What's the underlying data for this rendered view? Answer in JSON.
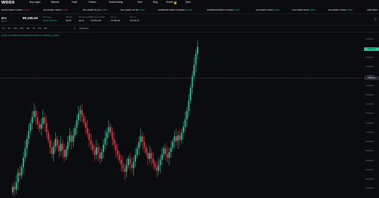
{
  "brand": {
    "name_prefix": "woo",
    "name_x": "x"
  },
  "nav": [
    {
      "label": "Buy crypto"
    },
    {
      "label": "Markets"
    },
    {
      "label": "Trade"
    },
    {
      "label": "Futures"
    },
    {
      "label": "Social trading"
    },
    {
      "label": "Earn"
    },
    {
      "label": "Blog"
    },
    {
      "label": "Events",
      "badge": "4"
    },
    {
      "label": "More"
    }
  ],
  "tickers": [
    {
      "symbol": "DOGE-PERP",
      "price": "0.20262",
      "change": "-0.80%",
      "dir": "neg"
    },
    {
      "symbol": "ETH-PERP",
      "price": "2,883.4",
      "change": "5.40%",
      "dir": "neg"
    },
    {
      "symbol": "BTC-PERP",
      "price": "81,322",
      "change": "6.20%",
      "dir": "pos"
    },
    {
      "symbol": "SOL-PERP",
      "price": "197.56",
      "change": "1.20%",
      "dir": "pos"
    },
    {
      "symbol": "1000BONK-PERP",
      "price": "0.029300",
      "change": "11.30%",
      "dir": "pos"
    },
    {
      "symbol": "1000PEPE-PERP",
      "price": "0.012000",
      "change": "6.40%",
      "dir": "pos"
    },
    {
      "symbol": "SUI-PERP",
      "price": "2.5264",
      "change": "9.20%",
      "dir": "pos"
    },
    {
      "symbol": "TAO-PERP",
      "price": "99.66",
      "change": "4.30%",
      "dir": "pos"
    },
    {
      "symbol": "ADA-PERP",
      "price": "0.3840",
      "change": "4.50%",
      "dir": "pos"
    },
    {
      "symbol": "ARB-PERP",
      "price": "",
      "change": "",
      "dir": "pos"
    }
  ],
  "header": {
    "pair": "BTC",
    "pair_sub": "Bitcoin",
    "last_price": "80,155.43",
    "stats": [
      {
        "label": "24h Change",
        "value": "4.64% 3,557.43",
        "dir": "pos"
      },
      {
        "label": "24h High",
        "value": "80,50"
      },
      {
        "label": "24h Volume(BTC)",
        "value": "99.26"
      },
      {
        "label": "24h Volume(USDT)",
        "value": "15,053,246"
      },
      {
        "label": "24h Low",
        "value": "75,580.95"
      },
      {
        "label": "24h Low",
        "value": "75,670.33"
      }
    ]
  },
  "toolbar": {
    "items": [
      "1m",
      "5m",
      "15m",
      "30m",
      "1h",
      "4h",
      "1D",
      "1W",
      "ƒx",
      "Indicators"
    ],
    "active_index": 4
  },
  "ohlc_legend": "O75377.40 H76472.52 L80159.94 C75375.43 +4235.20 (+4.65%)",
  "chart_data": {
    "type": "candlestick",
    "series": [
      {
        "o": 64600,
        "c": 65200
      },
      {
        "o": 65200,
        "c": 64900
      },
      {
        "o": 64900,
        "c": 65700
      },
      {
        "o": 65700,
        "c": 66700
      },
      {
        "o": 66700,
        "c": 66400
      },
      {
        "o": 66400,
        "c": 67300
      },
      {
        "o": 67300,
        "c": 68300
      },
      {
        "o": 68300,
        "c": 69300
      },
      {
        "o": 69300,
        "c": 70300
      },
      {
        "o": 70300,
        "c": 71200
      },
      {
        "o": 71200,
        "c": 72000
      },
      {
        "o": 72000,
        "c": 72700
      },
      {
        "o": 72700,
        "c": 73300
      },
      {
        "o": 73300,
        "c": 72600
      },
      {
        "o": 72600,
        "c": 71900
      },
      {
        "o": 71900,
        "c": 71400
      },
      {
        "o": 71400,
        "c": 71900
      },
      {
        "o": 71900,
        "c": 72600
      },
      {
        "o": 72600,
        "c": 72000
      },
      {
        "o": 72000,
        "c": 71000
      },
      {
        "o": 71000,
        "c": 70200
      },
      {
        "o": 70200,
        "c": 69400
      },
      {
        "o": 69400,
        "c": 68700
      },
      {
        "o": 68700,
        "c": 69500
      },
      {
        "o": 69500,
        "c": 70300
      },
      {
        "o": 70300,
        "c": 69600
      },
      {
        "o": 69600,
        "c": 69000
      },
      {
        "o": 69000,
        "c": 69800
      },
      {
        "o": 69800,
        "c": 69100
      },
      {
        "o": 69100,
        "c": 68400
      },
      {
        "o": 68400,
        "c": 69200
      },
      {
        "o": 69200,
        "c": 70000
      },
      {
        "o": 70000,
        "c": 70700
      },
      {
        "o": 70700,
        "c": 70000
      },
      {
        "o": 70000,
        "c": 70700
      },
      {
        "o": 70700,
        "c": 71500
      },
      {
        "o": 71500,
        "c": 72300
      },
      {
        "o": 72300,
        "c": 73000
      },
      {
        "o": 73000,
        "c": 73400
      },
      {
        "o": 73400,
        "c": 72700
      },
      {
        "o": 72700,
        "c": 72100
      },
      {
        "o": 72100,
        "c": 71500
      },
      {
        "o": 71500,
        "c": 70900
      },
      {
        "o": 70900,
        "c": 70200
      },
      {
        "o": 70200,
        "c": 69700
      },
      {
        "o": 69700,
        "c": 69100
      },
      {
        "o": 69100,
        "c": 68600
      },
      {
        "o": 68600,
        "c": 69400
      },
      {
        "o": 69400,
        "c": 68800
      },
      {
        "o": 68800,
        "c": 68200
      },
      {
        "o": 68200,
        "c": 68900
      },
      {
        "o": 68900,
        "c": 69700
      },
      {
        "o": 69700,
        "c": 70400
      },
      {
        "o": 70400,
        "c": 71000
      },
      {
        "o": 71000,
        "c": 71600
      },
      {
        "o": 71600,
        "c": 71000
      },
      {
        "o": 71000,
        "c": 70300
      },
      {
        "o": 70300,
        "c": 69700
      },
      {
        "o": 69700,
        "c": 69100
      },
      {
        "o": 69100,
        "c": 68600
      },
      {
        "o": 68600,
        "c": 68100
      },
      {
        "o": 68100,
        "c": 67600
      },
      {
        "o": 67600,
        "c": 67200
      },
      {
        "o": 67200,
        "c": 66800
      },
      {
        "o": 66800,
        "c": 67500
      },
      {
        "o": 67500,
        "c": 68200
      },
      {
        "o": 68200,
        "c": 67600
      },
      {
        "o": 67600,
        "c": 67200
      },
      {
        "o": 67200,
        "c": 67900
      },
      {
        "o": 67900,
        "c": 68600
      },
      {
        "o": 68600,
        "c": 69300
      },
      {
        "o": 69300,
        "c": 70000
      },
      {
        "o": 70000,
        "c": 70600
      },
      {
        "o": 70600,
        "c": 70000
      },
      {
        "o": 70000,
        "c": 69400
      },
      {
        "o": 69400,
        "c": 68800
      },
      {
        "o": 68800,
        "c": 68200
      },
      {
        "o": 68200,
        "c": 68800
      },
      {
        "o": 68800,
        "c": 68200
      },
      {
        "o": 68200,
        "c": 67700
      },
      {
        "o": 67700,
        "c": 67300
      },
      {
        "o": 67300,
        "c": 66900
      },
      {
        "o": 66900,
        "c": 67500
      },
      {
        "o": 67500,
        "c": 68100
      },
      {
        "o": 68100,
        "c": 68700
      },
      {
        "o": 68700,
        "c": 69300
      },
      {
        "o": 69300,
        "c": 68700
      },
      {
        "o": 68700,
        "c": 68300
      },
      {
        "o": 68300,
        "c": 68900
      },
      {
        "o": 68900,
        "c": 69400
      },
      {
        "o": 69400,
        "c": 70000
      },
      {
        "o": 70000,
        "c": 70600
      },
      {
        "o": 70600,
        "c": 70100
      },
      {
        "o": 70100,
        "c": 70700
      },
      {
        "o": 70700,
        "c": 70200
      },
      {
        "o": 70200,
        "c": 71000
      },
      {
        "o": 71000,
        "c": 71600
      },
      {
        "o": 71600,
        "c": 72400
      },
      {
        "o": 72400,
        "c": 73300
      },
      {
        "o": 73300,
        "c": 74400
      },
      {
        "o": 74400,
        "c": 75800
      },
      {
        "o": 75800,
        "c": 77000
      },
      {
        "o": 77000,
        "c": 78200
      },
      {
        "o": 78200,
        "c": 79400
      },
      {
        "o": 79400,
        "c": 80150
      }
    ],
    "ylim": [
      64000,
      81000
    ],
    "yticks": [
      "81,000.00",
      "80,000.00",
      "79,000.00",
      "78,000.00",
      "77,000.00",
      "76,000.00",
      "75,000.00",
      "74,000.00",
      "73,000.00",
      "72,000.00",
      "71,000.00",
      "70,000.00",
      "69,000.00",
      "68,000.00",
      "67,000.00",
      "66,000.00",
      "65,000.00"
    ],
    "last_price_label": "80155.43",
    "crosshair_label": "76826.37",
    "crosshair_value": 76826.37,
    "colors": {
      "up": "#20c997",
      "down": "#ea3943",
      "bg": "#0b0c0f"
    }
  }
}
